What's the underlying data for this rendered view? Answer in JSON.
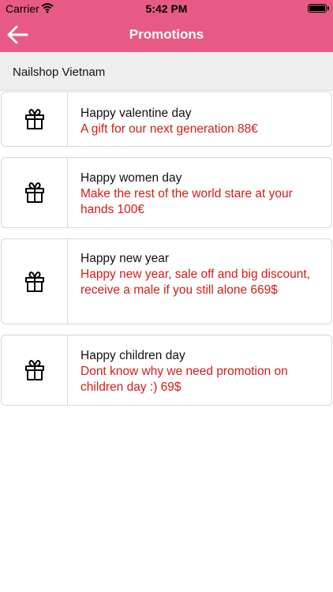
{
  "status": {
    "carrier": "Carrier",
    "time": "5:42 PM"
  },
  "nav": {
    "title": "Promotions",
    "back_icon": "arrow-left-icon",
    "bar_color": "#e85a86"
  },
  "section": {
    "title": "Nailshop Vietnam"
  },
  "promotions": [
    {
      "name": "Happy valentine day",
      "description": "A gift for our next generation 88€",
      "icon": "gift-icon"
    },
    {
      "name": "Happy women day",
      "description": "Make the rest of the world stare at your hands 100€",
      "icon": "gift-icon"
    },
    {
      "name": "Happy new year",
      "description": "Happy new year, sale off and big discount, receive a male if you still alone 669$",
      "icon": "gift-icon"
    },
    {
      "name": "Happy children day",
      "description": "Dont know why we need promotion on children day :) 69$",
      "icon": "gift-icon"
    }
  ],
  "colors": {
    "accent": "#e85a86",
    "promo_text": "#d61a1a"
  }
}
